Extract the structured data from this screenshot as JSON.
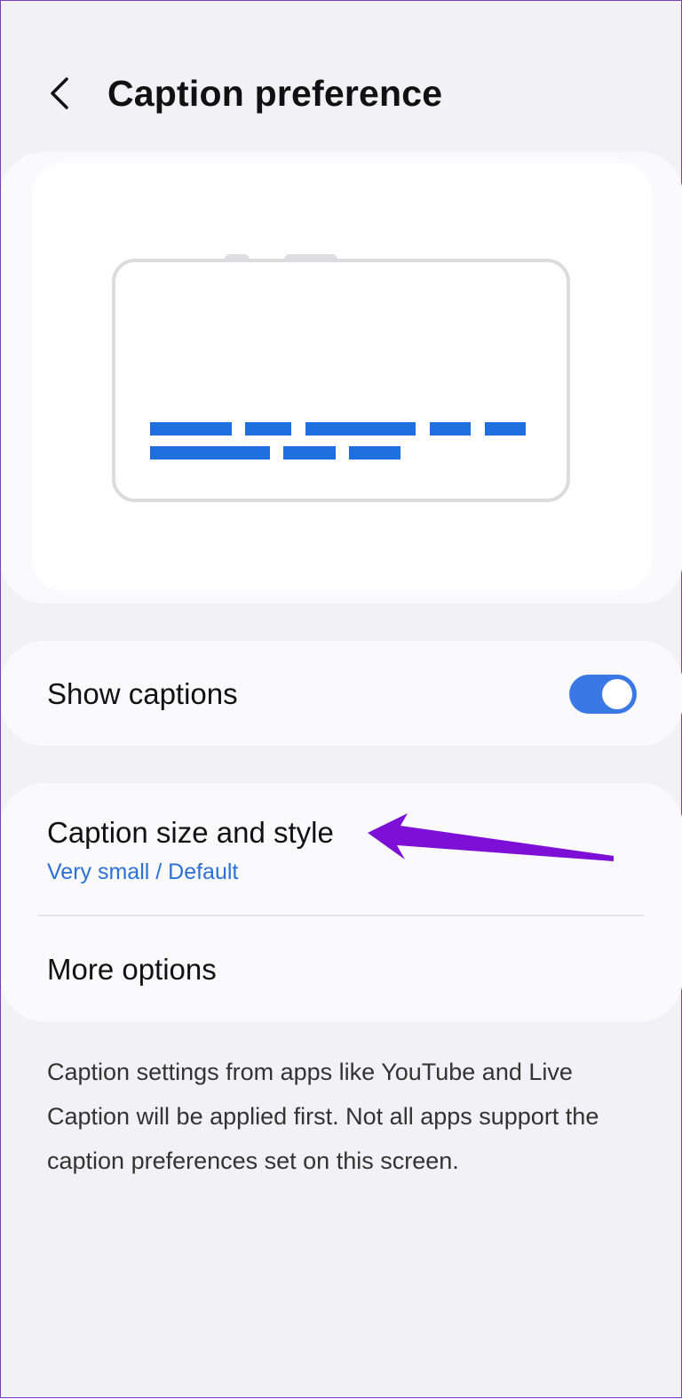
{
  "header": {
    "title": "Caption preference",
    "back_icon": "chevron-left-icon"
  },
  "colors": {
    "accent": "#3a78e6",
    "subtext": "#2b70d6",
    "caption_bar": "#1f6fe0",
    "background": "#f2f2f6",
    "card": "#fafafc",
    "annotation": "#7d0fd6"
  },
  "settings": {
    "show_captions": {
      "label": "Show captions",
      "enabled": true
    },
    "caption_size_style": {
      "label": "Caption size and style",
      "value": "Very small / Default"
    },
    "more_options": {
      "label": "More options"
    }
  },
  "info": {
    "text": "Caption settings from apps like YouTube and Live Caption will be applied first. Not all apps support the caption preferences set on this screen."
  }
}
